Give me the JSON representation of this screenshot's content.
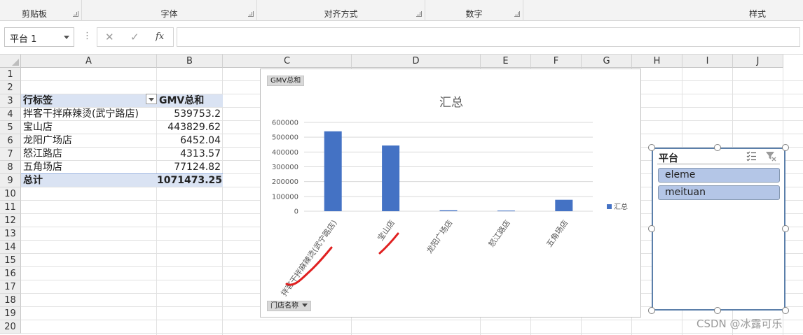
{
  "ribbon": {
    "groups": [
      {
        "label": "剪贴板"
      },
      {
        "label": "字体"
      },
      {
        "label": "对齐方式"
      },
      {
        "label": "数字"
      },
      {
        "label": "样式"
      }
    ]
  },
  "formula_bar": {
    "name_box": "平台 1",
    "cancel_icon": "✕",
    "enter_icon": "✓",
    "fx_label": "fx",
    "formula": ""
  },
  "sheet": {
    "columns": [
      "A",
      "B",
      "C",
      "D",
      "E",
      "F",
      "G",
      "H",
      "I",
      "J"
    ],
    "rows": [
      "1",
      "2",
      "3",
      "4",
      "5",
      "6",
      "7",
      "8",
      "9",
      "10",
      "11",
      "12",
      "13",
      "14",
      "15",
      "16",
      "17",
      "18",
      "19",
      "20"
    ]
  },
  "pivot": {
    "row_label_header": "行标签",
    "value_header": "GMV总和",
    "rows": [
      {
        "label": "拌客干拌麻辣烫(武宁路店)",
        "value": "539753.2"
      },
      {
        "label": "宝山店",
        "value": "443829.62"
      },
      {
        "label": "龙阳广场店",
        "value": "6452.04"
      },
      {
        "label": "怒江路店",
        "value": "4313.57"
      },
      {
        "label": "五角场店",
        "value": "77124.82"
      }
    ],
    "total_label": "总计",
    "total_value": "1071473.25"
  },
  "chart_data": {
    "type": "bar",
    "title": "汇总",
    "value_field_button": "GMV总和",
    "axis_field_button": "门店名称",
    "categories": [
      "拌客干拌麻辣烫(武宁路店)",
      "宝山店",
      "龙阳广场店",
      "怒江路店",
      "五角场店"
    ],
    "series": [
      {
        "name": "汇总",
        "values": [
          539753.2,
          443829.62,
          6452.04,
          4313.57,
          77124.82
        ],
        "color": "#4472c4"
      }
    ],
    "yticks": [
      "0",
      "100000",
      "200000",
      "300000",
      "400000",
      "500000",
      "600000"
    ],
    "ylim": [
      0,
      600000
    ],
    "grid": true,
    "legend": "right",
    "annotation_color": "#e02020"
  },
  "slicer": {
    "title": "平台",
    "items": [
      "eleme",
      "meituan"
    ],
    "multiselect_icon": "multi-select-icon",
    "clear_icon": "clear-filter-icon"
  },
  "watermark": "CSDN @冰露可乐"
}
